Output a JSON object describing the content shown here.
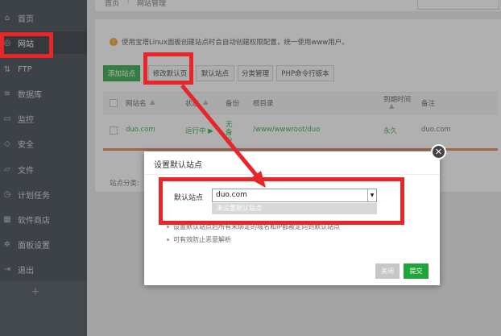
{
  "sidebar": {
    "items": [
      {
        "label": "首页",
        "icon": "home-icon"
      },
      {
        "label": "网站",
        "icon": "globe-icon"
      },
      {
        "label": "FTP",
        "icon": "ftp-icon"
      },
      {
        "label": "数据库",
        "icon": "database-icon"
      },
      {
        "label": "监控",
        "icon": "monitor-icon"
      },
      {
        "label": "安全",
        "icon": "shield-icon"
      },
      {
        "label": "文件",
        "icon": "folder-icon"
      },
      {
        "label": "计划任务",
        "icon": "clock-icon"
      },
      {
        "label": "软件商店",
        "icon": "store-icon"
      },
      {
        "label": "面板设置",
        "icon": "gear-icon"
      },
      {
        "label": "退出",
        "icon": "exit-icon"
      }
    ],
    "add_label": "+"
  },
  "breadcrumb": {
    "home": "首页",
    "sep": "/",
    "current": "网站管理"
  },
  "notice": "使用宝塔Linux面板创建站点时会自动创建权限配置，统一使用www用户。",
  "toolbar": {
    "add_site": "添加站点",
    "edit_default_page": "修改默认页",
    "default_site": "默认站点",
    "category_manage": "分类管理",
    "php_cli_version": "PHP命令行版本"
  },
  "table": {
    "headers": {
      "name": "网站名",
      "status": "状态",
      "backup": "备份",
      "root": "根目录",
      "expire": "到期时间",
      "remark": "备注"
    },
    "rows": [
      {
        "name": "duo.com",
        "status": "运行中 ▶",
        "backup": "无备份",
        "root": "/www/wwwroot/duo",
        "expire": "永久",
        "remark": "duo.com"
      }
    ]
  },
  "footer": {
    "category_label": "站点分类:"
  },
  "dialog": {
    "title": "设置默认站点",
    "label": "默认站点",
    "selected": "duo.com",
    "option_unset": "未设置默认站点",
    "tips": [
      "设置默认站点后所有未绑定的域名和IP都被定向到默认站点",
      "可有效防止恶意解析"
    ],
    "cancel": "关闭",
    "submit": "提交"
  },
  "colors": {
    "accent": "#20a53a",
    "highlight": "#e8262a",
    "sidebar_bg": "#2f3740"
  }
}
